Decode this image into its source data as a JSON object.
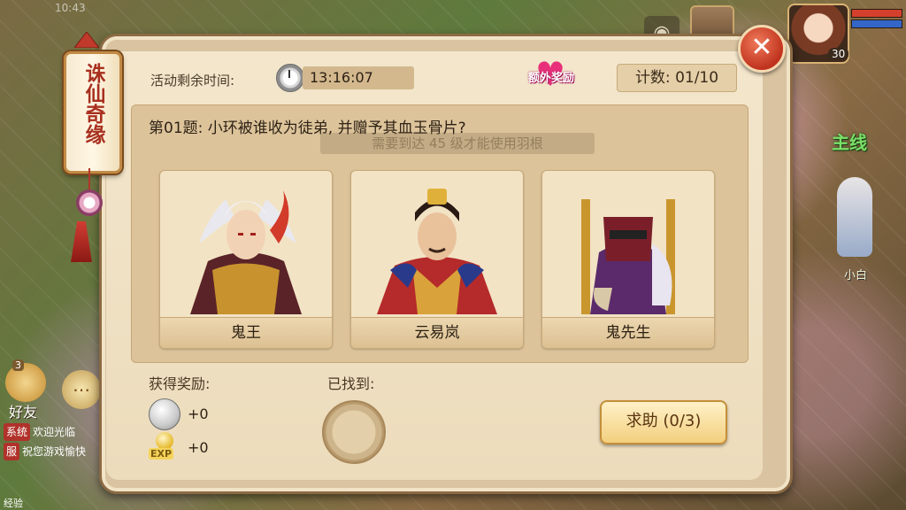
{
  "status_bar": {
    "time": "10:43"
  },
  "hud": {
    "level": "30",
    "camera_icon": "camera-icon"
  },
  "side": {
    "main_quest_label": "主线",
    "npc_name": "小白",
    "friend_label": "好友",
    "friend_count": "3",
    "chat": [
      {
        "tag": "系统",
        "text": "欢迎光临"
      },
      {
        "tag": "服",
        "text": "祝您游戏愉快"
      }
    ],
    "exp_label": "经验"
  },
  "event": {
    "scroll_title": "诛仙奇缘",
    "time_label": "活动剩余时间:",
    "time_value": "13:16:07",
    "bonus_label": "额外奖励",
    "count_label": "计数: 01/10",
    "question": "第01题: 小环被谁收为徒弟, 并赠予其血玉骨片?",
    "faded_tip": "需要到达 45 级才能使用羽根",
    "options": [
      {
        "name": "鬼王"
      },
      {
        "name": "云易岚"
      },
      {
        "name": "鬼先生"
      }
    ],
    "reward_label": "获得奖励:",
    "found_label": "已找到:",
    "rewards": [
      {
        "icon": "silver-coin-icon",
        "value": "+0"
      },
      {
        "icon": "exp-icon",
        "value": "+0"
      }
    ],
    "exp_text": "EXP",
    "help_button": "求助 (0/3)",
    "close_symbol": "✕"
  },
  "colors": {
    "accent_red": "#c0331e",
    "panel": "#ecdcbc",
    "heart": "#e8307a",
    "quest_green": "#7be06a"
  }
}
